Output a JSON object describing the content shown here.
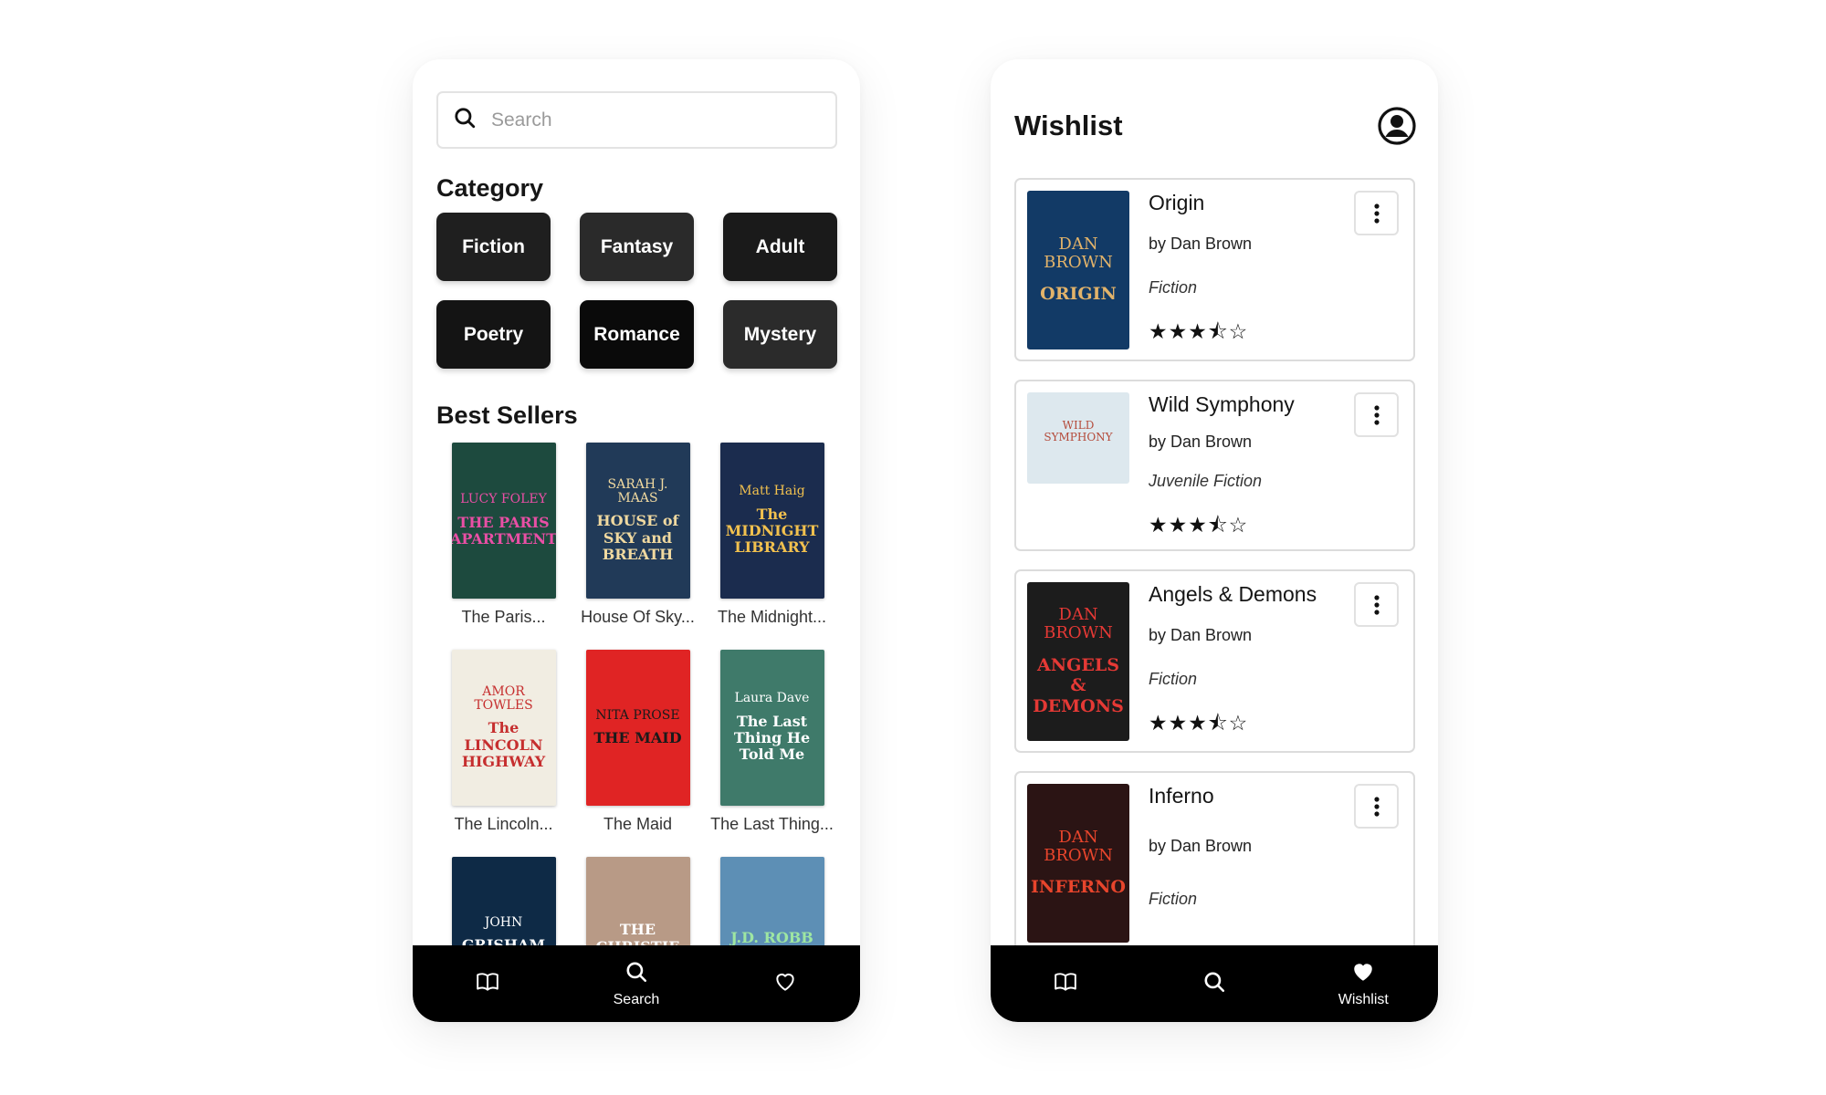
{
  "search_screen": {
    "search": {
      "placeholder": "Search",
      "value": ""
    },
    "category_title": "Category",
    "categories": [
      {
        "label": "Fiction",
        "color": "#1f1f1f"
      },
      {
        "label": "Fantasy",
        "color": "#2a2a2a"
      },
      {
        "label": "Adult",
        "color": "#1a1a1a"
      },
      {
        "label": "Poetry",
        "color": "#141414"
      },
      {
        "label": "Romance",
        "color": "#0a0a0a"
      },
      {
        "label": "Mystery",
        "color": "#2b2b2b"
      }
    ],
    "bestsellers_title": "Best Sellers",
    "books": [
      {
        "title": "The Paris...",
        "cover": {
          "author": "LUCY FOLEY",
          "name": "THE PARIS APARTMENT",
          "bg": "#1d4a3e",
          "fg": "#e94fa5"
        }
      },
      {
        "title": "House Of Sky...",
        "cover": {
          "author": "SARAH J. MAAS",
          "name": "HOUSE of SKY and BREATH",
          "bg": "#213a58",
          "fg": "#f0d9a0"
        }
      },
      {
        "title": "The Midnight...",
        "cover": {
          "author": "Matt Haig",
          "name": "The MIDNIGHT LIBRARY",
          "bg": "#1b2c4e",
          "fg": "#f2c14e"
        }
      },
      {
        "title": "The Lincoln...",
        "cover": {
          "author": "AMOR TOWLES",
          "name": "The LINCOLN HIGHWAY",
          "bg": "#f1ede2",
          "fg": "#c62f2f"
        }
      },
      {
        "title": "The Maid",
        "cover": {
          "author": "NITA PROSE",
          "name": "THE MAID",
          "bg": "#e02424",
          "fg": "#1a1a1a"
        }
      },
      {
        "title": "The Last Thing...",
        "cover": {
          "author": "Laura Dave",
          "name": "The Last Thing He Told Me",
          "bg": "#3f7a6a",
          "fg": "#ffffff"
        }
      },
      {
        "title": "",
        "cover": {
          "author": "JOHN",
          "name": "GRISHAM",
          "bg": "#0e2a46",
          "fg": "#ffffff"
        }
      },
      {
        "title": "",
        "cover": {
          "author": "",
          "name": "THE CHRISTIE",
          "bg": "#b89a86",
          "fg": "#ffffff"
        }
      },
      {
        "title": "",
        "cover": {
          "author": "",
          "name": "J.D. ROBB",
          "bg": "#5d8fb5",
          "fg": "#9ee6a2"
        }
      }
    ],
    "tabbar": {
      "active_label": "Search"
    }
  },
  "wishlist_screen": {
    "title": "Wishlist",
    "items": [
      {
        "name": "Origin",
        "author": "by Dan Brown",
        "genre": "Fiction",
        "stars": "★★★⯪☆",
        "cover": {
          "top": "DAN BROWN",
          "bottom": "ORIGIN",
          "bg": "#123a66",
          "fg": "#e2b36a"
        }
      },
      {
        "name": "Wild Symphony",
        "author": "by Dan Brown",
        "genre": "Juvenile Fiction",
        "stars": "★★★⯪☆",
        "cover": {
          "top": "WILD SYMPHONY",
          "bottom": "",
          "bg": "#dde8ee",
          "fg": "#b44a3a"
        }
      },
      {
        "name": "Angels & Demons",
        "author": "by Dan Brown",
        "genre": "Fiction",
        "stars": "★★★⯪☆",
        "cover": {
          "top": "DAN BROWN",
          "bottom": "ANGELS & DEMONS",
          "bg": "#1c1c1c",
          "fg": "#e53935"
        }
      },
      {
        "name": "Inferno",
        "author": "by Dan Brown",
        "genre": "Fiction",
        "stars": "",
        "cover": {
          "top": "DAN BROWN",
          "bottom": "INFERNO",
          "bg": "#2b1414",
          "fg": "#e8452c"
        }
      }
    ],
    "tabbar": {
      "active_label": "Wishlist"
    }
  }
}
